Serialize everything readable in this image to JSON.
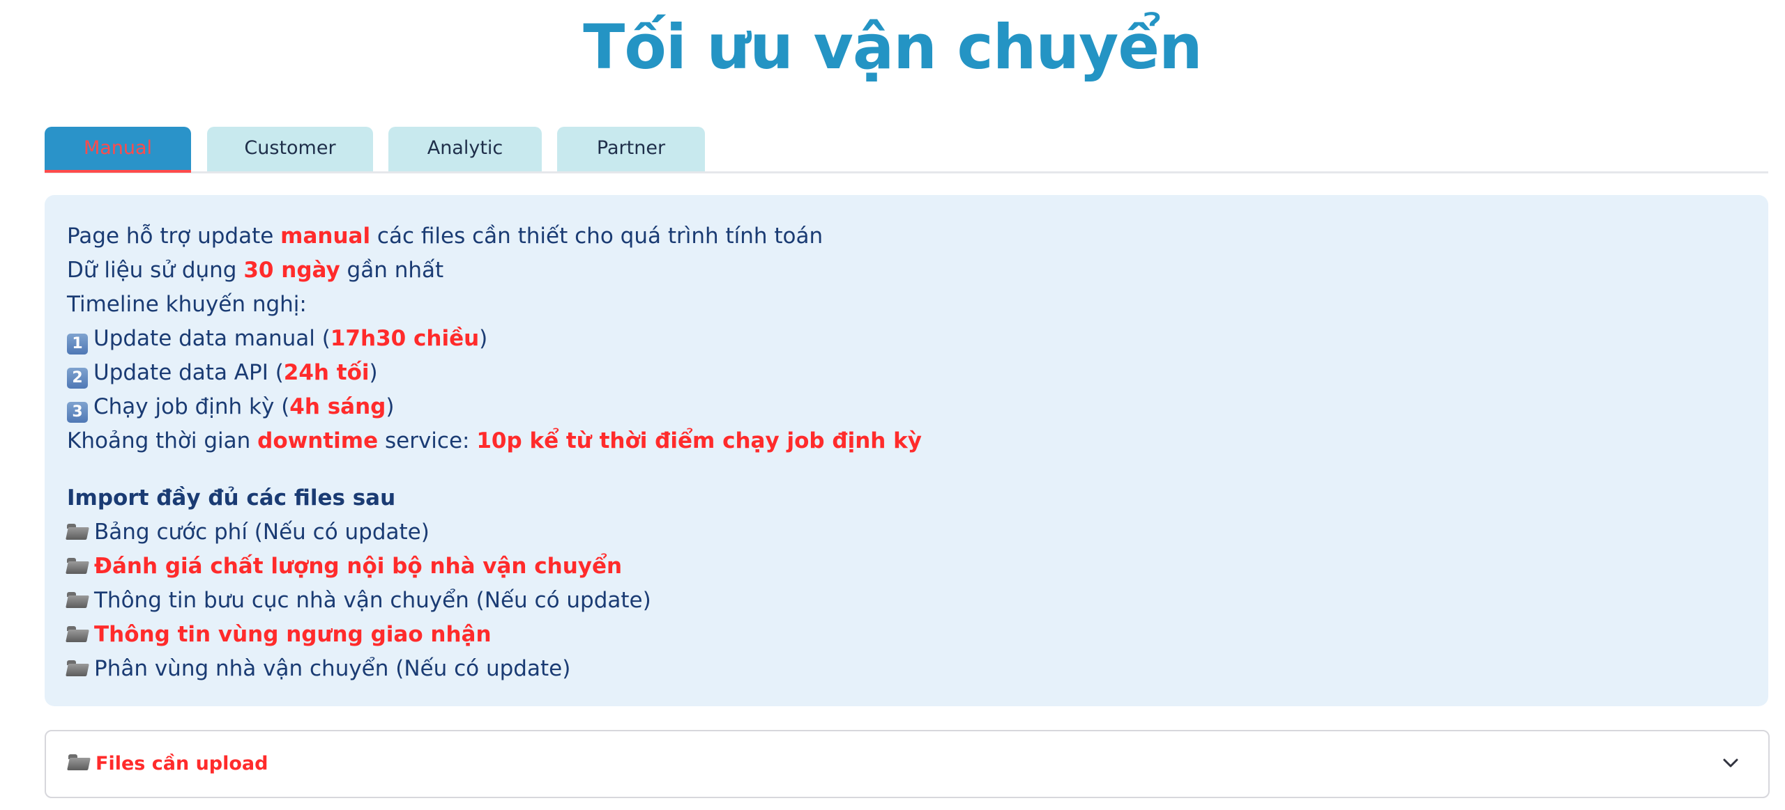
{
  "page": {
    "title": "Tối ưu vận chuyển"
  },
  "tabs": [
    {
      "label": "Manual",
      "active": true
    },
    {
      "label": "Customer",
      "active": false
    },
    {
      "label": "Analytic",
      "active": false
    },
    {
      "label": "Partner",
      "active": false
    }
  ],
  "info": {
    "line1": {
      "before": "Page hỗ trợ update ",
      "highlight": "manual",
      "after": " các files cần thiết cho quá trình tính toán"
    },
    "line2": {
      "before": "Dữ liệu sử dụng ",
      "highlight": "30 ngày",
      "after": " gần nhất"
    },
    "line3": {
      "text": "Timeline khuyến nghị:"
    },
    "steps": [
      {
        "badge": "1",
        "before": "Update data manual (",
        "highlight": "17h30 chiều",
        "after": ")"
      },
      {
        "badge": "2",
        "before": "Update data API (",
        "highlight": "24h tối",
        "after": ")"
      },
      {
        "badge": "3",
        "before": "Chạy job định kỳ (",
        "highlight": "4h sáng",
        "after": ")"
      }
    ],
    "downtime": {
      "before": "Khoảng thời gian ",
      "highlight": "downtime",
      "middle": " service: ",
      "value": "10p kể từ thời điểm chạy job định kỳ"
    },
    "import_heading": "Import đầy đủ các files sau",
    "files": [
      {
        "label": "Bảng cước phí (Nếu có update)",
        "required": false
      },
      {
        "label": "Đánh giá chất lượng nội bộ nhà vận chuyển",
        "required": true
      },
      {
        "label": "Thông tin bưu cục nhà vận chuyển (Nếu có update)",
        "required": false
      },
      {
        "label": "Thông tin vùng ngưng giao nhận",
        "required": true
      },
      {
        "label": "Phân vùng nhà vận chuyển (Nếu có update)",
        "required": false
      }
    ],
    "icons": {
      "file": "folder-icon",
      "step": "keycap-number-icon"
    }
  },
  "expander": {
    "label": "Files cần upload",
    "icon": "folder-icon",
    "toggle_icon": "chevron-down-icon"
  },
  "colors": {
    "title": "#2494c4",
    "active_tab": "#2a93c9",
    "inactive_tab": "#c8e9ee",
    "highlight": "#ff2b2b",
    "panel": "#e6f1fa",
    "text": "#1a3b73"
  }
}
